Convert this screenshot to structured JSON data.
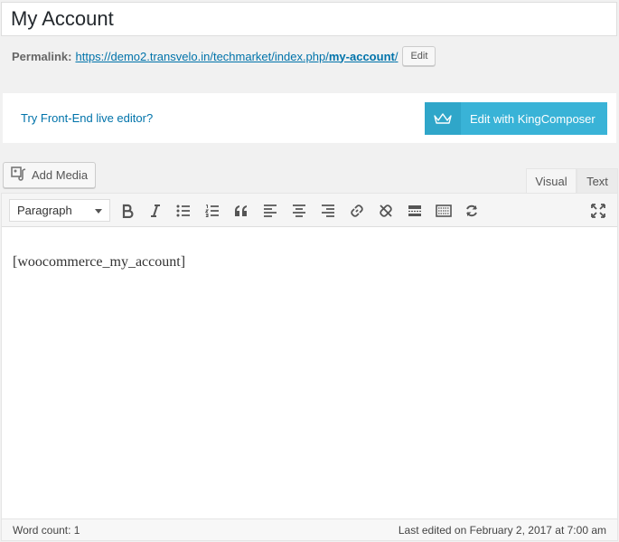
{
  "title": {
    "value": "My Account"
  },
  "permalink": {
    "label": "Permalink:",
    "url_prefix": "https://demo2.transvelo.in/techmarket/index.php/",
    "slug": "my-account",
    "url_suffix": "/",
    "edit_label": "Edit"
  },
  "kingcomposer": {
    "live_editor_link": "Try Front-End live editor?",
    "edit_button": "Edit with KingComposer",
    "accent": "#39b3d7"
  },
  "media": {
    "add_media_label": "Add Media"
  },
  "tabs": {
    "visual": "Visual",
    "text": "Text"
  },
  "toolbar": {
    "format_selected": "Paragraph",
    "buttons": [
      "bold",
      "italic",
      "bulleted-list",
      "numbered-list",
      "blockquote",
      "align-left",
      "align-center",
      "align-right",
      "insert-link",
      "remove-link",
      "read-more",
      "toolbar-toggle",
      "wordpress-switch",
      "fullscreen"
    ]
  },
  "editor": {
    "content": "[woocommerce_my_account]"
  },
  "status": {
    "word_count": "Word count: 1",
    "last_edited": "Last edited on February 2, 2017 at 7:00 am"
  }
}
